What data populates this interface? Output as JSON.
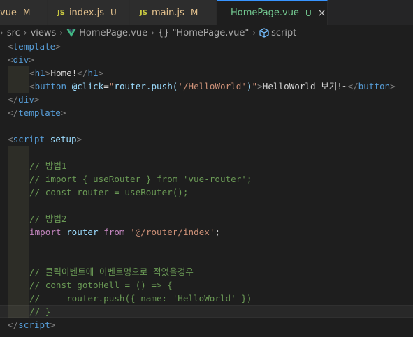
{
  "tabs": [
    {
      "name": "vue",
      "status": "M"
    },
    {
      "name": "index.js",
      "status": "U",
      "icon": "JS"
    },
    {
      "name": "main.js",
      "status": "M",
      "icon": "JS"
    },
    {
      "name": "HomePage.vue",
      "status": "U",
      "close": "×"
    }
  ],
  "breadcrumb": {
    "items": [
      "src",
      "views",
      "HomePage.vue",
      "\"HomePage.vue\"",
      "script"
    ],
    "braces": "{}"
  },
  "code": {
    "l1": {
      "open": "<",
      "tag": "template",
      "close": ">"
    },
    "l2": {
      "open": "<",
      "tag": "div",
      "close": ">"
    },
    "l3": {
      "open": "<",
      "tag": "h1",
      "close": ">",
      "text": "Home!",
      "endopen": "</",
      "endtag": "h1",
      "endclose": ">"
    },
    "l4": {
      "open": "<",
      "tag": "button",
      "attr": "@click",
      "eq": "=",
      "quote1": "\"",
      "fncall": "router.push(",
      "arg": "'/HelloWorld'",
      "paren": ")",
      "quote2": "\"",
      "close": ">",
      "text": "HelloWorld 보기!~",
      "endopen": "</",
      "endtag": "button",
      "endclose": ">"
    },
    "l5": {
      "open": "</",
      "tag": "div",
      "close": ">"
    },
    "l6": {
      "open": "</",
      "tag": "template",
      "close": ">"
    },
    "l8": {
      "open": "<",
      "tag": "script",
      "attr": "setup",
      "close": ">"
    },
    "l10": "// 방법1",
    "l11": "// import { useRouter } from 'vue-router';",
    "l12": "// const router = useRouter();",
    "l14": "// 방법2",
    "l15": {
      "kw1": "import",
      "var": "router",
      "kw2": "from",
      "str": "'@/router/index'",
      "semi": ";"
    },
    "l18": "// 클릭이벤트에 이벤트명으로 적었을경우",
    "l19": "// const gotoHell = () => {",
    "l20": "//     router.push({ name: 'HelloWorld' })",
    "l21": "// }",
    "l22": {
      "open": "</",
      "tag": "script",
      "close": ">"
    }
  }
}
